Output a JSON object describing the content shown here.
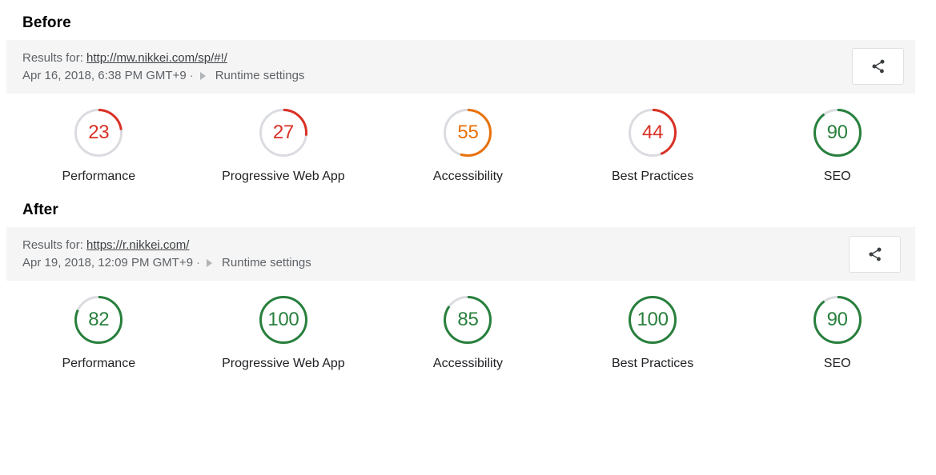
{
  "colors": {
    "red": "#d93025",
    "orange": "#e8710a",
    "green": "#28803d",
    "track": "#dadce0",
    "bar_background": "#f5f5f5",
    "text": "#202124",
    "muted_text": "#5f6368"
  },
  "sections": [
    {
      "heading": "Before",
      "results": {
        "results_for_label": "Results for:",
        "url": "http://mw.nikkei.com/sp/#!/",
        "timestamp": "Apr 16, 2018, 6:38 PM GMT+9",
        "separator": "·",
        "runtime_settings_label": "Runtime settings",
        "caret_icon": "triangle-right-icon",
        "share_button": {
          "icon": "share-icon",
          "title": "Share"
        }
      },
      "gauges": [
        {
          "score": "23",
          "value": 23,
          "label": "Performance",
          "color": "#d93025"
        },
        {
          "score": "27",
          "value": 27,
          "label": "Progressive Web App",
          "color": "#d93025"
        },
        {
          "score": "55",
          "value": 55,
          "label": "Accessibility",
          "color": "#e8710a"
        },
        {
          "score": "44",
          "value": 44,
          "label": "Best Practices",
          "color": "#d93025"
        },
        {
          "score": "90",
          "value": 90,
          "label": "SEO",
          "color": "#28803d"
        }
      ]
    },
    {
      "heading": "After",
      "results": {
        "results_for_label": "Results for:",
        "url": "https://r.nikkei.com/",
        "timestamp": "Apr 19, 2018, 12:09 PM GMT+9",
        "separator": "·",
        "runtime_settings_label": "Runtime settings",
        "caret_icon": "triangle-right-icon",
        "share_button": {
          "icon": "share-icon",
          "title": "Share"
        }
      },
      "gauges": [
        {
          "score": "82",
          "value": 82,
          "label": "Performance",
          "color": "#28803d"
        },
        {
          "score": "100",
          "value": 100,
          "label": "Progressive Web App",
          "color": "#28803d"
        },
        {
          "score": "85",
          "value": 85,
          "label": "Accessibility",
          "color": "#28803d"
        },
        {
          "score": "100",
          "value": 100,
          "label": "Best Practices",
          "color": "#28803d"
        },
        {
          "score": "90",
          "value": 90,
          "label": "SEO",
          "color": "#28803d"
        }
      ]
    }
  ]
}
